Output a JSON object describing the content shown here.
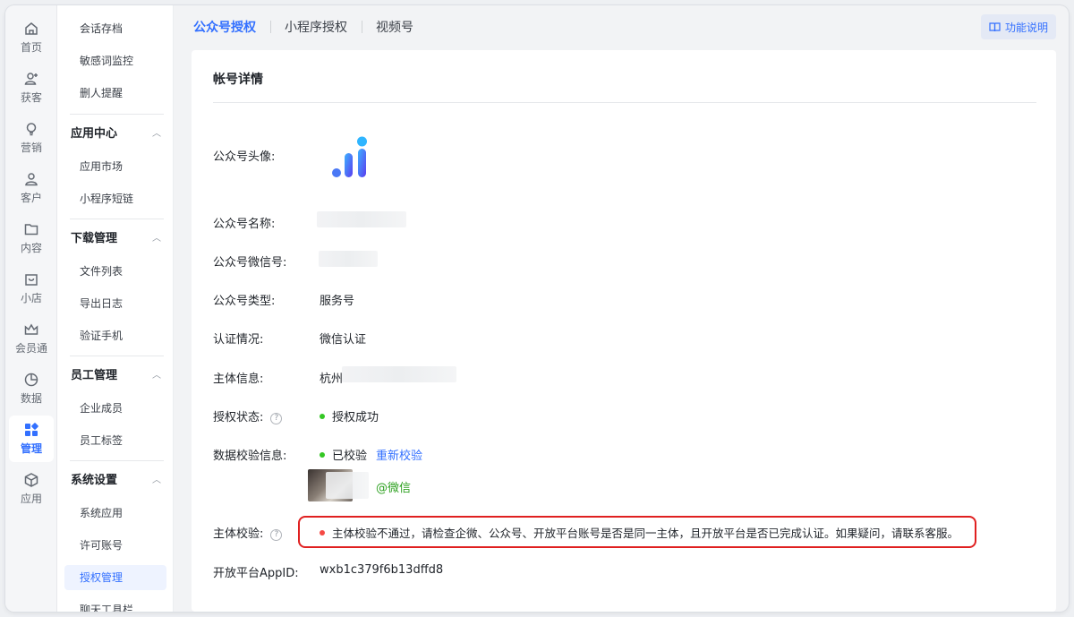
{
  "rail": {
    "items": [
      {
        "label": "首页",
        "icon": "home-icon"
      },
      {
        "label": "获客",
        "icon": "user-add-icon"
      },
      {
        "label": "营销",
        "icon": "bulb-icon"
      },
      {
        "label": "客户",
        "icon": "user-icon"
      },
      {
        "label": "内容",
        "icon": "folder-icon"
      },
      {
        "label": "小店",
        "icon": "shop-icon"
      },
      {
        "label": "会员通",
        "icon": "crown-icon"
      },
      {
        "label": "数据",
        "icon": "pie-chart-icon"
      },
      {
        "label": "管理",
        "icon": "grid-icon",
        "active": true
      },
      {
        "label": "应用",
        "icon": "cube-icon"
      }
    ]
  },
  "sidebar": {
    "top_items": [
      "会话存档",
      "敏感词监控",
      "删人提醒"
    ],
    "groups": [
      {
        "title": "应用中心",
        "items": [
          "应用市场",
          "小程序短链"
        ]
      },
      {
        "title": "下载管理",
        "items": [
          "文件列表",
          "导出日志",
          "验证手机"
        ]
      },
      {
        "title": "员工管理",
        "items": [
          "企业成员",
          "员工标签"
        ]
      },
      {
        "title": "系统设置",
        "items": [
          "系统应用",
          "许可账号",
          "授权管理",
          "聊天工具栏"
        ]
      }
    ],
    "active_item": "授权管理"
  },
  "tabs": {
    "items": [
      "公众号授权",
      "小程序授权",
      "视频号"
    ],
    "active": "公众号授权",
    "help_label": "功能说明"
  },
  "card": {
    "title": "帐号详情",
    "fields": {
      "avatar_label": "公众号头像:",
      "name_label": "公众号名称:",
      "wechat_id_label": "公众号微信号:",
      "type_label": "公众号类型:",
      "type_value": "服务号",
      "cert_label": "认证情况:",
      "cert_value": "微信认证",
      "entity_label": "主体信息:",
      "entity_value": "杭州",
      "auth_status_label": "授权状态:",
      "auth_status_value": "授权成功",
      "data_check_label": "数据校验信息:",
      "data_check_value": "已校验",
      "recheck_link": "重新校验",
      "wechat_suffix": "@微信",
      "entity_check_label": "主体校验:",
      "entity_check_value": "主体校验不通过，请检查企微、公众号、开放平台账号是否是同一主体，且开放平台是否已完成认证。如果疑问，请联系客服。",
      "appid_label": "开放平台AppID:",
      "appid_value": "wxb1c379f6b13dffd8"
    }
  },
  "colors": {
    "accent": "#3370ff",
    "success": "#34c724",
    "error": "#f54a45",
    "highlight_border": "#e02020"
  }
}
